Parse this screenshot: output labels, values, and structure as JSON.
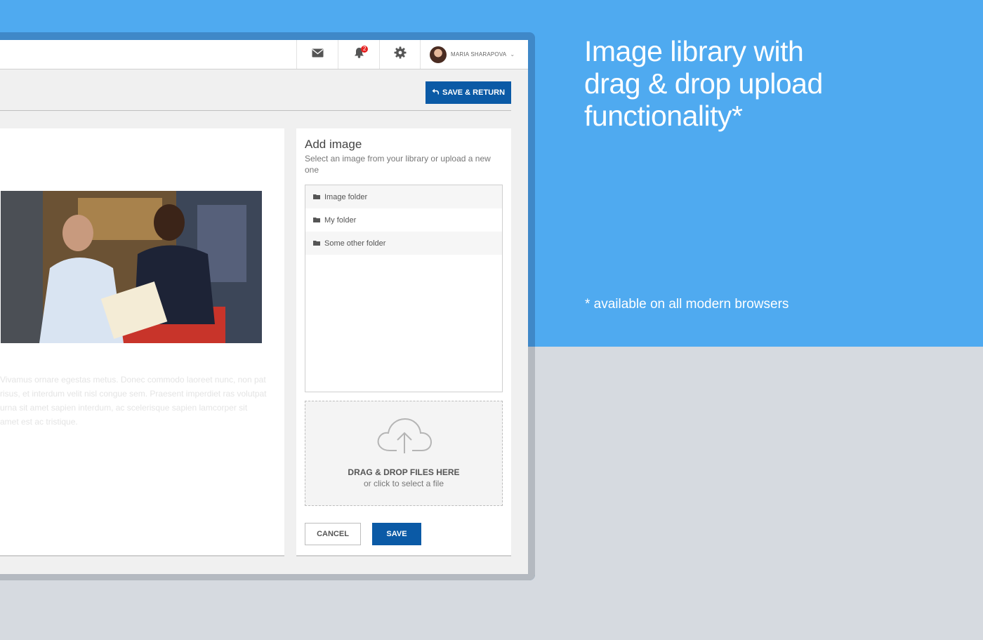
{
  "marketing": {
    "headline_line1": "Image library with",
    "headline_line2": "drag & drop upload",
    "headline_line3": "functionality*",
    "footnote": "* available on all modern browsers"
  },
  "topbar": {
    "icons": [
      "mail-icon",
      "bell-icon",
      "gear-icon"
    ],
    "notification_count": "2",
    "user_name": "MARIA SHARAPOVA"
  },
  "toolbar": {
    "save_return_label": "SAVE & RETURN"
  },
  "content": {
    "lorem": "Vivamus ornare egestas metus. Donec commodo laoreet nunc, non pat risus, et interdum velit nisl congue sem. Praesent imperdiet ras volutpat urna sit amet sapien interdum, ac scelerisque sapien lamcorper sit amet est ac tristique."
  },
  "panel": {
    "title": "Add image",
    "subtitle": "Select an image from your library or upload a new one",
    "folders": [
      "Image folder",
      "My folder",
      "Some other folder"
    ],
    "dropzone_title": "DRAG & DROP FILES HERE",
    "dropzone_subtitle": "or click to select a file",
    "cancel_label": "CANCEL",
    "save_label": "SAVE"
  },
  "colors": {
    "marketing_bg": "#4faaf0",
    "primary_button": "#0b5aa6",
    "page_bg": "#d6dae0",
    "badge": "#e62222"
  }
}
